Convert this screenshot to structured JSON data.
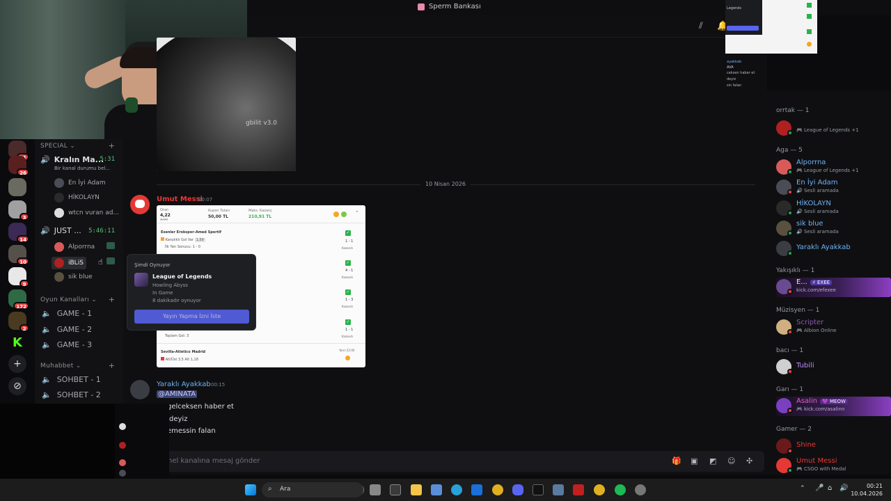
{
  "window": {
    "title": "Sperm Bankası"
  },
  "server_rail": {
    "badges": [
      "11",
      "26",
      "3",
      "14",
      "10",
      "9",
      "172",
      "2"
    ]
  },
  "channels": {
    "special": {
      "label": "SPECIAL"
    },
    "vc1": {
      "name": "Kralın Ma...",
      "time": "5:31",
      "status": "Bir kanal durumu bel..."
    },
    "vc1_users": [
      "En İyi Adam",
      "HİKOLAYN",
      "wtcn vuran ad..."
    ],
    "vc2": {
      "name": "JUST ...",
      "time": "5:46:11"
    },
    "vc2_users": [
      "Alporrna",
      "iBLiS",
      "sik blue"
    ],
    "oyun": {
      "label": "Oyun Kanalları"
    },
    "games": [
      "GAME - 1",
      "GAME - 2",
      "GAME - 3"
    ],
    "muhabbet": {
      "label": "Muhabbet"
    },
    "sohbet": [
      "SOHBET - 1",
      "SOHBET - 2"
    ]
  },
  "chat": {
    "image_label": "gbilit v3.0",
    "date_divider": "10 Nisan 2026",
    "msg1": {
      "author": "Umut Messi",
      "time": "00:07"
    },
    "slip": {
      "oran_label": "Oran",
      "oran": "4,22",
      "oran_old": "3,00",
      "kupon_label": "Kupon Tutarı",
      "kupon": "50,00 TL",
      "maks_label": "Maks. Kazanç",
      "maks": "210,91 TL",
      "m1": "Esenler Erokspor-Amed Sportif",
      "m1_pick": "Karşılıklı Gol Var",
      "m1_odd": "1,59",
      "m1_res": "İlk Yarı Sonucu: 1 - 0",
      "scores": [
        "1 - 1",
        "4 - 1",
        "1 - 3",
        "1 - 1"
      ],
      "won": "Kazandı",
      "total_goal": "Toplam Gol: 3",
      "m5": "Sevilla-Atletico Madrid",
      "m5_pick": "Alt/Üst 3,5 Alt",
      "m5_odd": "1,18",
      "m5_time": "Yarın 22:00"
    },
    "msg2": {
      "author": "Yaraklı Ayakkab",
      "time": "00:15",
      "mention": "@AMINATA",
      "lines": [
        "gelceksen haber et",
        "deyiz",
        "emessin falan"
      ]
    },
    "composer_placeholder": "nel kanalına mesaj gönder"
  },
  "popup": {
    "header": "Şimdi Oynuyor",
    "game": "League of Legends",
    "detail1": "Howling Abyss",
    "detail2": "In Game",
    "detail3": "8 dakikadır oynuyor",
    "button": "Yayın Yapma İzni İste"
  },
  "members": {
    "orrtak": "orrtak — 1",
    "orrtak_act": "League of Legends +1",
    "aga": "Aga — 5",
    "aga_list": [
      {
        "name": "Alporrna",
        "act": "League of Legends +1"
      },
      {
        "name": "En İyi Adam",
        "act": "Sesli aramada"
      },
      {
        "name": "HİKOLAYN",
        "act": "Sesli aramada"
      },
      {
        "name": "sik blue",
        "act": "Sesli aramada"
      },
      {
        "name": "Yaraklı Ayakkab",
        "act": ""
      }
    ],
    "yakisikli": "Yakışıklı — 1",
    "efexee": {
      "name": "E...",
      "tag": "⚡ EXEE",
      "act": "kick.com/efexee"
    },
    "muzisyen": "Müzisyen — 1",
    "scripter": {
      "name": "Scripter",
      "act": "Albion Online"
    },
    "baci": "bacı — 1",
    "tubili": {
      "name": "Tubili"
    },
    "gari": "Garı — 1",
    "asalin": {
      "name": "Asalin",
      "tag": "💜 MEOW",
      "act": "kick.com/asalinn"
    },
    "gamer": "Gamer — 2",
    "shine": {
      "name": "Shine"
    },
    "umut": {
      "name": "Umut Messi",
      "act": "CSGO with Medal"
    }
  },
  "top_right_mini": {
    "lines": [
      "Legends",
      "AVA",
      "ceksen haber et",
      "deyiz",
      "sin falan"
    ],
    "author": "ayakkab"
  },
  "taskbar": {
    "search": "Ara",
    "time": "00:21",
    "date": "10.04.2026"
  },
  "colors": {
    "accent": "#5865f2",
    "online": "#23a55a",
    "dnd": "#f23f43",
    "red_name": "#e53935",
    "blue_name": "#6cb2f7",
    "purple_name": "#b98bf5"
  }
}
